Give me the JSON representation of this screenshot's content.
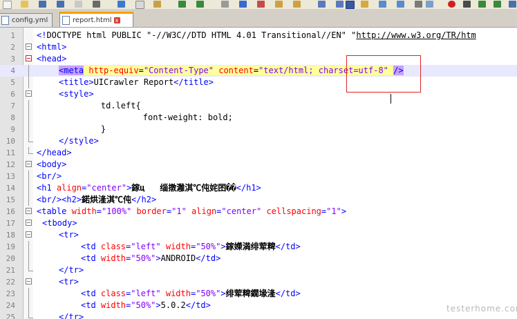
{
  "tabs": [
    {
      "label": "config.yml",
      "active": false
    },
    {
      "label": "report.html",
      "active": true
    }
  ],
  "watermark": "testerhome.com",
  "lines": [
    {
      "num": "1",
      "fold": "",
      "tokens": [
        [
          "tag",
          "<!"
        ],
        [
          "text",
          "DOCTYPE html PUBLIC \"-//W3C//DTD HTML 4.01 Transitional//EN\" \""
        ],
        [
          "url",
          "http://www.w3.org/TR/htm"
        ]
      ]
    },
    {
      "num": "2",
      "fold": "open",
      "tokens": [
        [
          "tag",
          "<html>"
        ]
      ]
    },
    {
      "num": "3",
      "fold": "open-red",
      "tokens": [
        [
          "tag",
          "<head>"
        ]
      ]
    },
    {
      "num": "4",
      "fold": "",
      "current": true,
      "tokens": [
        [
          "tag-hl",
          "<meta"
        ],
        [
          "text",
          " "
        ],
        [
          "attr",
          "http-equiv"
        ],
        [
          "text",
          "="
        ],
        [
          "str",
          "\"Content-Type\""
        ],
        [
          "text",
          " "
        ],
        [
          "attr",
          "content"
        ],
        [
          "text",
          "="
        ],
        [
          "str",
          "\"text/html; charset=utf-8\""
        ],
        [
          "text",
          " "
        ],
        [
          "tag-hl",
          "/>"
        ]
      ]
    },
    {
      "num": "5",
      "fold": "",
      "tokens": [
        [
          "tag",
          "<title>"
        ],
        [
          "text",
          "UICrawler Report"
        ],
        [
          "tag",
          "</title>"
        ]
      ]
    },
    {
      "num": "6",
      "fold": "open",
      "tokens": [
        [
          "tag",
          "<style>"
        ]
      ]
    },
    {
      "num": "7",
      "fold": "",
      "tokens": [
        [
          "text",
          "    td.left{"
        ]
      ]
    },
    {
      "num": "8",
      "fold": "",
      "tokens": [
        [
          "text",
          "        font-weight: bold;"
        ]
      ]
    },
    {
      "num": "9",
      "fold": "",
      "tokens": [
        [
          "text",
          "    }"
        ]
      ]
    },
    {
      "num": "10",
      "fold": "end",
      "tokens": [
        [
          "tag",
          "</style>"
        ]
      ]
    },
    {
      "num": "11",
      "fold": "end",
      "tokens": [
        [
          "tag",
          "</head>"
        ]
      ]
    },
    {
      "num": "12",
      "fold": "open",
      "tokens": [
        [
          "tag",
          "<body>"
        ]
      ]
    },
    {
      "num": "13",
      "fold": "",
      "tokens": [
        [
          "tag",
          "<br/>"
        ]
      ]
    },
    {
      "num": "14",
      "fold": "",
      "tokens": [
        [
          "tag",
          "<h1 "
        ],
        [
          "attr",
          "align"
        ],
        [
          "tag",
          "="
        ],
        [
          "str",
          "\"center\""
        ],
        [
          "tag",
          ">"
        ],
        [
          "bold",
          "鎵ц   缁撴灉淇℃伅姹囨��"
        ],
        [
          "tag",
          "</h1>"
        ]
      ]
    },
    {
      "num": "15",
      "fold": "",
      "tokens": [
        [
          "tag",
          "<br/><h2>"
        ],
        [
          "bold",
          "鍩烘湰淇℃伅"
        ],
        [
          "tag",
          "</h2>"
        ]
      ]
    },
    {
      "num": "16",
      "fold": "open",
      "tokens": [
        [
          "tag",
          "<table "
        ],
        [
          "attr",
          "width"
        ],
        [
          "tag",
          "="
        ],
        [
          "str",
          "\"100%\""
        ],
        [
          "text",
          " "
        ],
        [
          "attr",
          "border"
        ],
        [
          "tag",
          "="
        ],
        [
          "str",
          "\"1\""
        ],
        [
          "text",
          " "
        ],
        [
          "attr",
          "align"
        ],
        [
          "tag",
          "="
        ],
        [
          "str",
          "\"center\""
        ],
        [
          "text",
          " "
        ],
        [
          "attr",
          "cellspacing"
        ],
        [
          "tag",
          "="
        ],
        [
          "str",
          "\"1\""
        ],
        [
          "tag",
          ">"
        ]
      ]
    },
    {
      "num": "17",
      "fold": "open",
      "tokens": [
        [
          "tag",
          "<tbody>"
        ]
      ]
    },
    {
      "num": "18",
      "fold": "open",
      "tokens": [
        [
          "tag",
          "<tr>"
        ]
      ]
    },
    {
      "num": "19",
      "fold": "",
      "tokens": [
        [
          "tag",
          "<td "
        ],
        [
          "attr",
          "class"
        ],
        [
          "tag",
          "="
        ],
        [
          "str",
          "\"left\""
        ],
        [
          "text",
          " "
        ],
        [
          "attr",
          "width"
        ],
        [
          "tag",
          "="
        ],
        [
          "str",
          "\"50%\""
        ],
        [
          "tag",
          ">"
        ],
        [
          "bold",
          "鎵嬫満绯荤粺"
        ],
        [
          "tag",
          "</td>"
        ]
      ]
    },
    {
      "num": "20",
      "fold": "",
      "tokens": [
        [
          "tag",
          "<td "
        ],
        [
          "attr",
          "width"
        ],
        [
          "tag",
          "="
        ],
        [
          "str",
          "\"50%\""
        ],
        [
          "tag",
          ">"
        ],
        [
          "text",
          "ANDROID"
        ],
        [
          "tag",
          "</td>"
        ]
      ]
    },
    {
      "num": "21",
      "fold": "end",
      "tokens": [
        [
          "tag",
          "</tr>"
        ]
      ]
    },
    {
      "num": "22",
      "fold": "open",
      "tokens": [
        [
          "tag",
          "<tr>"
        ]
      ]
    },
    {
      "num": "23",
      "fold": "",
      "tokens": [
        [
          "tag",
          "<td "
        ],
        [
          "attr",
          "class"
        ],
        [
          "tag",
          "="
        ],
        [
          "str",
          "\"left\""
        ],
        [
          "text",
          " "
        ],
        [
          "attr",
          "width"
        ],
        [
          "tag",
          "="
        ],
        [
          "str",
          "\"50%\""
        ],
        [
          "tag",
          ">"
        ],
        [
          "bold",
          "绯荤粺鐗堟湰"
        ],
        [
          "tag",
          "</td>"
        ]
      ]
    },
    {
      "num": "24",
      "fold": "",
      "tokens": [
        [
          "tag",
          "<td "
        ],
        [
          "attr",
          "width"
        ],
        [
          "tag",
          "="
        ],
        [
          "str",
          "\"50%\""
        ],
        [
          "tag",
          ">"
        ],
        [
          "text",
          "5.0.2"
        ],
        [
          "tag",
          "</td>"
        ]
      ]
    },
    {
      "num": "25",
      "fold": "end",
      "tokens": [
        [
          "tag",
          "</tr>"
        ]
      ]
    }
  ]
}
